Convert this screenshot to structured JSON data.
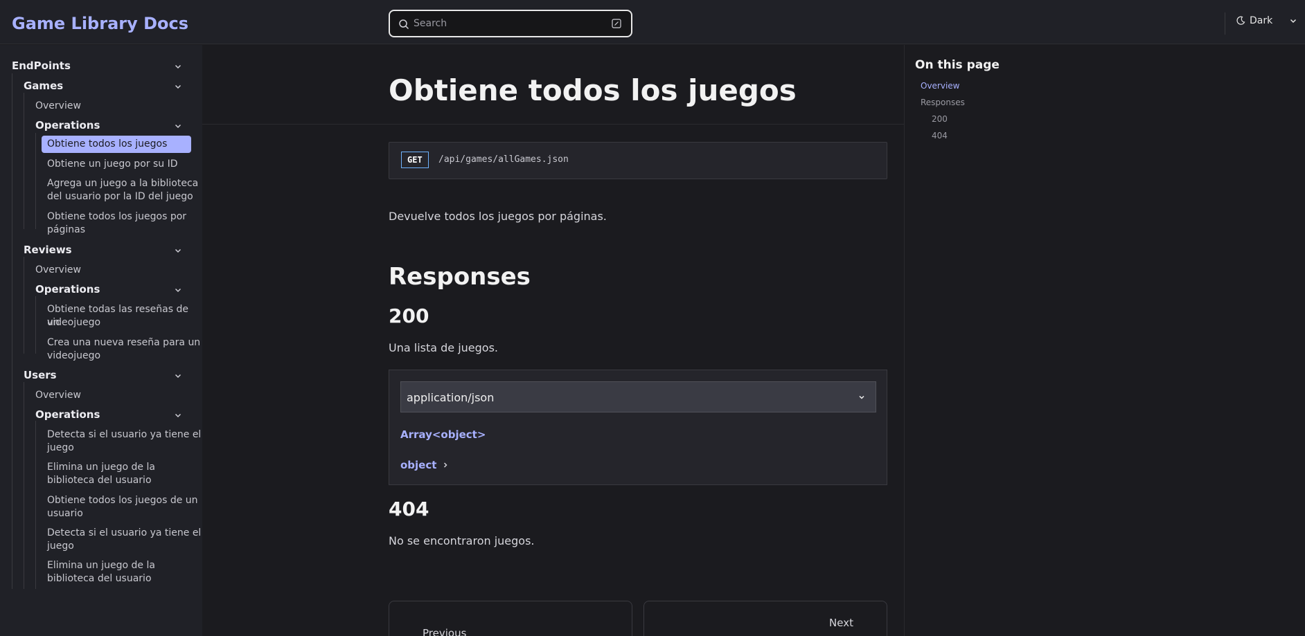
{
  "header": {
    "brand": "Game Library Docs",
    "search_placeholder": "Search",
    "theme_label": "Dark",
    "icons": {
      "search": "search-icon",
      "keyboard": "keyboard-shortcut-icon",
      "theme": "moon-icon",
      "chevron": "chevron-down-icon"
    }
  },
  "sidebar": {
    "root": "EndPoints",
    "games": {
      "label": "Games",
      "overview": "Overview",
      "operations": "Operations",
      "items": [
        "Obtiene todos los juegos",
        "Obtiene un juego por su ID",
        "Agrega un juego a la biblioteca",
        "del usuario por la ID del juego",
        "Obtiene todos los juegos por",
        "páginas"
      ]
    },
    "reviews": {
      "label": "Reviews",
      "overview": "Overview",
      "operations": "Operations",
      "items": [
        "Obtiene todas las reseñas de un",
        "videojuego",
        "Crea una nueva reseña para un",
        "videojuego"
      ]
    },
    "users": {
      "label": "Users",
      "overview": "Overview",
      "operations": "Operations",
      "items": [
        "Detecta si el usuario ya tiene el",
        "juego",
        "Elimina un juego de la",
        "biblioteca del usuario",
        "Obtiene todos los juegos de un",
        "usuario",
        "Detecta si el usuario ya tiene el",
        "juego",
        "Elimina un juego de la",
        "biblioteca del usuario"
      ]
    }
  },
  "main": {
    "title": "Obtiene todos los juegos",
    "method": "GET",
    "path": "/api/games/allGames.json",
    "description": "Devuelve todos los juegos por páginas.",
    "responses_heading": "Responses",
    "r200": {
      "code": "200",
      "text": "Una lista de juegos.",
      "content_type": "application/json",
      "schema_type": "Array<object>",
      "item_type": "object"
    },
    "r404": {
      "code": "404",
      "text": "No se encontraron juegos."
    },
    "pager": {
      "prev": "Previous",
      "next": "Next"
    }
  },
  "toc": {
    "title": "On this page",
    "items": [
      "Overview",
      "Responses",
      "200",
      "404"
    ]
  },
  "colors": {
    "accent": "#a8b1ff",
    "bg": "#1b1b1f",
    "sidebar": "#202127",
    "method_border": "#6fb3ff"
  }
}
